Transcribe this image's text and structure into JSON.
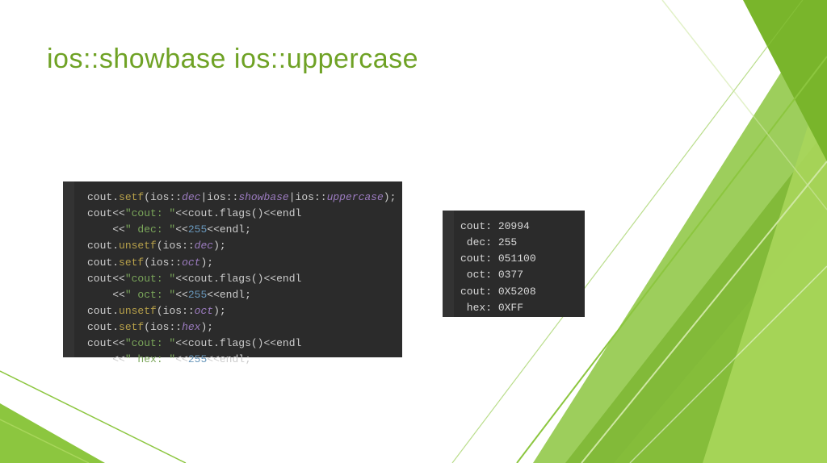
{
  "title": "ios::showbase ios::uppercase",
  "code": {
    "l1": {
      "obj": "cout",
      "meth": "setf",
      "a1": "dec",
      "a2": "showbase",
      "a3": "uppercase"
    },
    "l2": {
      "obj": "cout",
      "str": "\"cout: \"",
      "call": "cout.flags()",
      "end": "endl"
    },
    "l3": {
      "str": "\" dec: \"",
      "num": "255",
      "end": "endl"
    },
    "l4": {
      "obj": "cout",
      "meth": "unsetf",
      "a1": "dec"
    },
    "l5": {
      "obj": "cout",
      "meth": "setf",
      "a1": "oct"
    },
    "l6": {
      "obj": "cout",
      "str": "\"cout: \"",
      "call": "cout.flags()",
      "end": "endl"
    },
    "l7": {
      "str": "\" oct: \"",
      "num": "255",
      "end": "endl"
    },
    "l8": {
      "obj": "cout",
      "meth": "unsetf",
      "a1": "oct"
    },
    "l9": {
      "obj": "cout",
      "meth": "setf",
      "a1": "hex"
    },
    "l10": {
      "obj": "cout",
      "str": "\"cout: \"",
      "call": "cout.flags()",
      "end": "endl"
    },
    "l11": {
      "str": "\" hex: \"",
      "num": "255",
      "end": "endl"
    }
  },
  "out": {
    "r1": {
      "k": "cout:",
      "v": "20994"
    },
    "r2": {
      "k": " dec:",
      "v": "255"
    },
    "r3": {
      "k": "cout:",
      "v": "051100"
    },
    "r4": {
      "k": " oct:",
      "v": "0377"
    },
    "r5": {
      "k": "cout:",
      "v": "0X5208"
    },
    "r6": {
      "k": " hex:",
      "v": "0XFF"
    }
  }
}
